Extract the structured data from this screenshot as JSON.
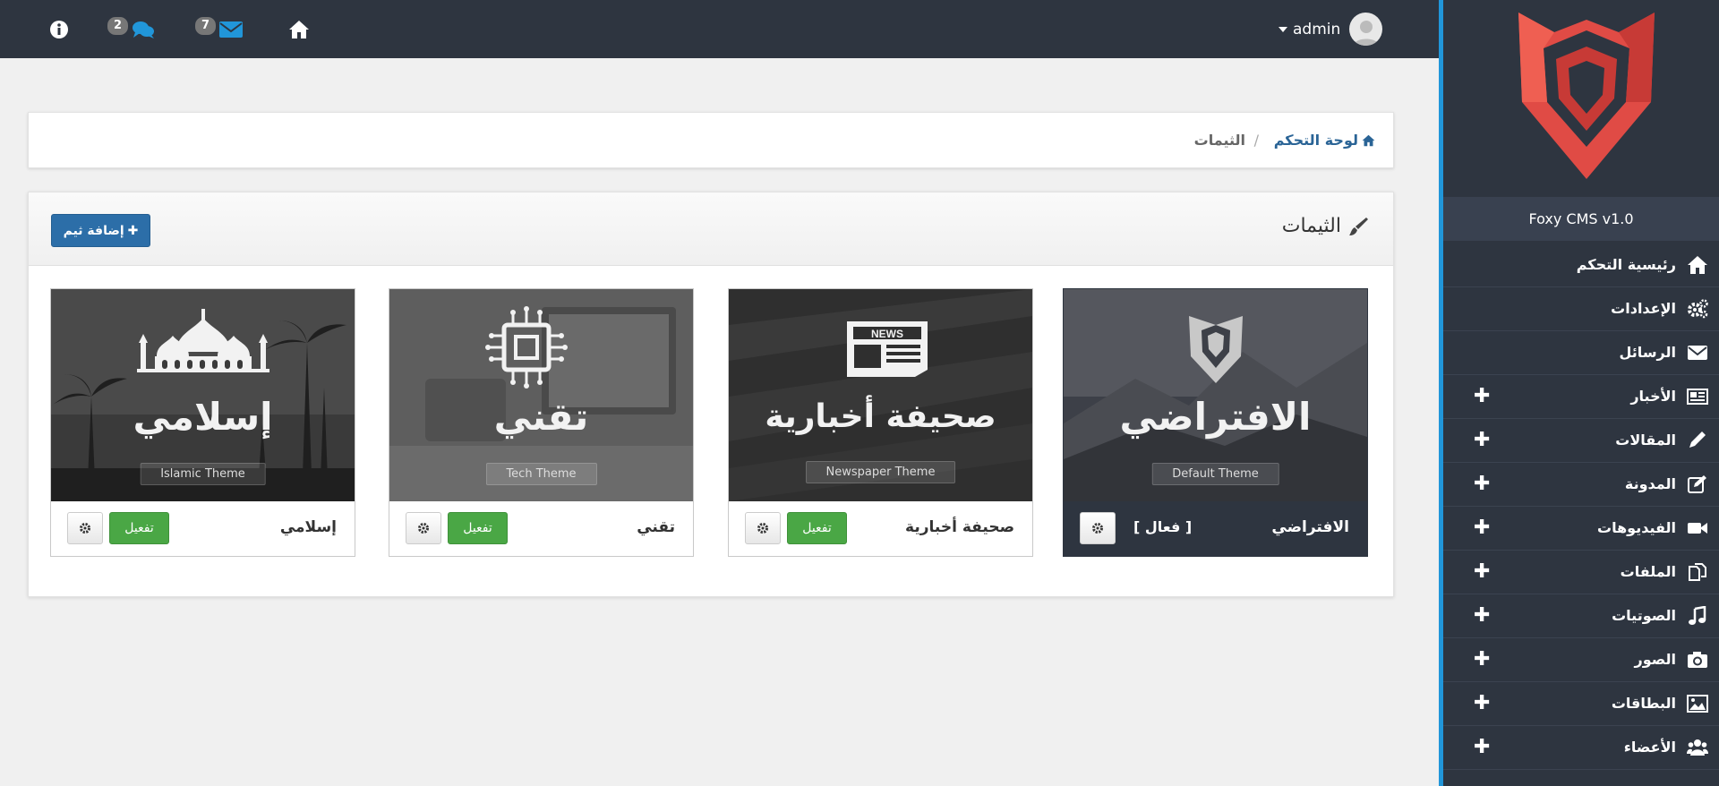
{
  "topbar": {
    "comments_count": "2",
    "messages_count": "7",
    "username": "admin"
  },
  "sidebar": {
    "brand": "Foxy CMS v1.0",
    "items": [
      {
        "label": "رئيسية التحكم",
        "icon": "home-icon",
        "expandable": false
      },
      {
        "label": "الإعدادات",
        "icon": "gears-icon",
        "expandable": false
      },
      {
        "label": "الرسائل",
        "icon": "envelope-icon",
        "expandable": false
      },
      {
        "label": "الأخبار",
        "icon": "newspaper-icon",
        "expandable": true
      },
      {
        "label": "المقالات",
        "icon": "pencil-icon",
        "expandable": true
      },
      {
        "label": "المدونة",
        "icon": "edit-icon",
        "expandable": true
      },
      {
        "label": "الفيديوهات",
        "icon": "video-camera-icon",
        "expandable": true
      },
      {
        "label": "الملفات",
        "icon": "files-icon",
        "expandable": true
      },
      {
        "label": "الصوتيات",
        "icon": "music-icon",
        "expandable": true
      },
      {
        "label": "الصور",
        "icon": "camera-icon",
        "expandable": true
      },
      {
        "label": "البطاقات",
        "icon": "picture-icon",
        "expandable": true
      },
      {
        "label": "الأعضاء",
        "icon": "users-icon",
        "expandable": true
      }
    ]
  },
  "breadcrumb": {
    "home": "لوحة التحكم",
    "separator": "/",
    "current": "الثيمات"
  },
  "panel": {
    "title": "الثيمات",
    "add_button": "إضافة ثيم"
  },
  "themes": [
    {
      "name": "الافتراضي",
      "status": "[ فعال ]",
      "image_title": "الافتراضي",
      "image_caption": "Default Theme",
      "active": true
    },
    {
      "name": "صحيفة أخبارية",
      "action": "تفعيل",
      "image_title": "صحيفة أخبارية",
      "image_caption": "Newspaper Theme",
      "image_badge": "NEWS",
      "active": false
    },
    {
      "name": "تقني",
      "action": "تفعيل",
      "image_title": "تقني",
      "image_caption": "Tech Theme",
      "active": false
    },
    {
      "name": "إسلامي",
      "action": "تفعيل",
      "image_title": "إسلامي",
      "image_caption": "Islamic Theme",
      "active": false
    }
  ],
  "colors": {
    "dark_bg": "#2e3540",
    "accent_blue": "#2196d9",
    "primary_button": "#2c6ea8",
    "success_button": "#4aa745",
    "logo_red": "#e04b45"
  }
}
